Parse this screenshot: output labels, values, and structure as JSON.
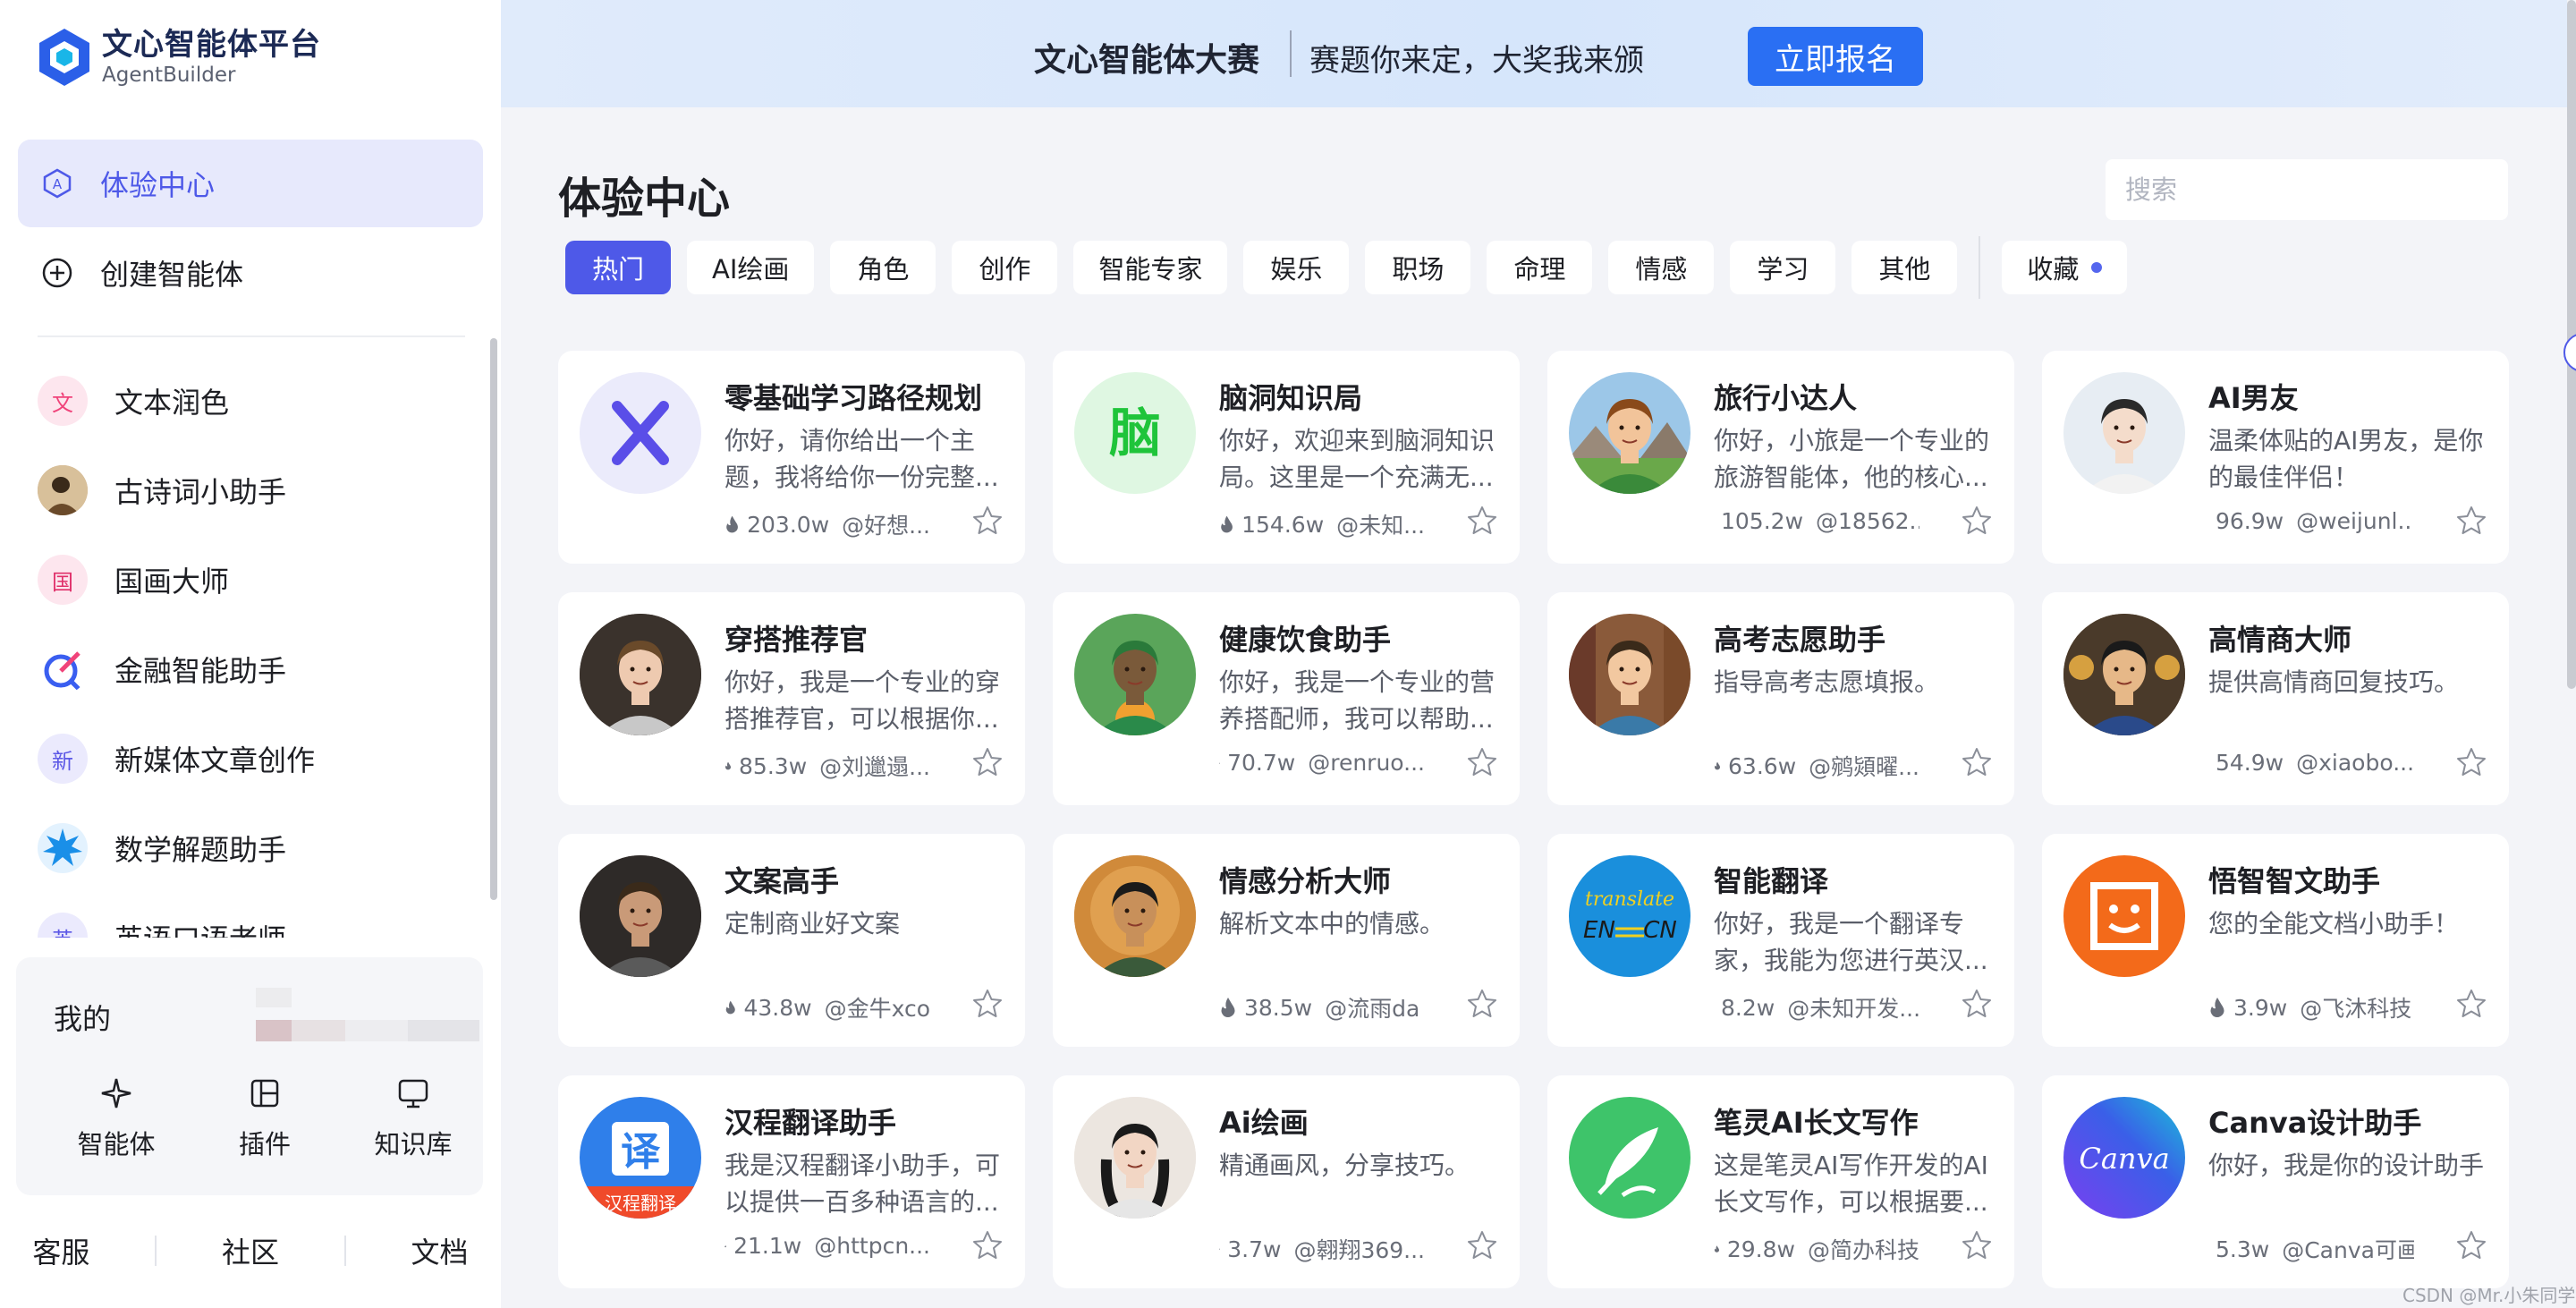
{
  "brand": {
    "title": "文心智能体平台",
    "subtitle": "AgentBuilder"
  },
  "nav": {
    "experience": "体验中心",
    "create": "创建智能体"
  },
  "recent": [
    {
      "label": "文本润色",
      "icon_text": "文",
      "color": "#f0437a",
      "bg": "#fde6ee"
    },
    {
      "label": "古诗词小助手",
      "icon_text": "",
      "color": "#7a5a3a",
      "bg": "#c9a27a"
    },
    {
      "label": "国画大师",
      "icon_text": "国",
      "color": "#e0306a",
      "bg": "#fde6ee"
    },
    {
      "label": "金融智能助手",
      "icon_text": "",
      "color": "#3a5ef0",
      "bg": "#ffffff"
    },
    {
      "label": "新媒体文章创作",
      "icon_text": "新",
      "color": "#5c58e6",
      "bg": "#ebeafd"
    },
    {
      "label": "数学解题助手",
      "icon_text": "",
      "color": "#1a8fe8",
      "bg": "#e3f2fe"
    },
    {
      "label": "英语口语老师",
      "icon_text": "英",
      "color": "#5c58e6",
      "bg": "#ebeafd"
    }
  ],
  "mine": {
    "label": "我的",
    "tabs": [
      "智能体",
      "插件",
      "知识库"
    ]
  },
  "footer": [
    "客服",
    "社区",
    "文档"
  ],
  "banner": {
    "title": "文心智能体大赛",
    "subtitle": "赛题你来定，大奖我来颁",
    "button": "立即报名"
  },
  "page": {
    "title": "体验中心",
    "search_placeholder": "搜索"
  },
  "categories": [
    "热门",
    "AI绘画",
    "角色",
    "创作",
    "智能专家",
    "娱乐",
    "职场",
    "命理",
    "情感",
    "学习",
    "其他"
  ],
  "favorites": "收藏",
  "cards": [
    {
      "title": "零基础学习路径规划",
      "desc": "你好，请你给出一个主题，我将给你一份完整...",
      "views": "203.0w",
      "author": "@好想...",
      "avatar": "x-mark",
      "bg": "#ebebfb"
    },
    {
      "title": "脑洞知识局",
      "desc": "你好，欢迎来到脑洞知识局。这里是一个充满无...",
      "views": "154.6w",
      "author": "@未知...",
      "avatar": "brain-char",
      "bg": "#dff7e2"
    },
    {
      "title": "旅行小达人",
      "desc": "你好，小旅是一个专业的旅游智能体，他的核心...",
      "views": "105.2w",
      "author": "@18562...",
      "avatar": "traveler",
      "bg": "#9cc7e8"
    },
    {
      "title": "AI男友",
      "desc": "温柔体贴的AI男友，是你的最佳伴侣！",
      "views": "96.9w",
      "author": "@weijunl...",
      "avatar": "boyfriend",
      "bg": "#e7edf3"
    },
    {
      "title": "穿搭推荐官",
      "desc": "你好，我是一个专业的穿搭推荐官，可以根据你...",
      "views": "85.3w",
      "author": "@刘邋遢...",
      "avatar": "fashion",
      "bg": "#4a4038"
    },
    {
      "title": "健康饮食助手",
      "desc": "你好，我是一个专业的营养搭配师，我可以帮助...",
      "views": "70.7w",
      "author": "@renruo...",
      "avatar": "diet",
      "bg": "#5aa55a"
    },
    {
      "title": "高考志愿助手",
      "desc": "指导高考志愿填报。",
      "views": "63.6w",
      "author": "@鹓熲曜...",
      "avatar": "exam",
      "bg": "#8a5a3a"
    },
    {
      "title": "高情商大师",
      "desc": "提供高情商回复技巧。",
      "views": "54.9w",
      "author": "@xiaobo...",
      "avatar": "eq",
      "bg": "#6a5030"
    },
    {
      "title": "文案高手",
      "desc": "定制商业好文案",
      "views": "43.8w",
      "author": "@金牛xco",
      "avatar": "copywriter",
      "bg": "#5a4a42"
    },
    {
      "title": "情感分析大师",
      "desc": "解析文本中的情感。",
      "views": "38.5w",
      "author": "@流雨da",
      "avatar": "emotion",
      "bg": "#c07a3a"
    },
    {
      "title": "智能翻译",
      "desc": "你好，我是一个翻译专家，我能为您进行英汉...",
      "views": "8.2w",
      "author": "@未知开发...",
      "avatar": "translate",
      "bg": "#1a8fdc"
    },
    {
      "title": "悟智智文助手",
      "desc": "您的全能文档小助手！",
      "views": "3.9w",
      "author": "@飞沐科技",
      "avatar": "doc-face",
      "bg": "#f36a1a"
    },
    {
      "title": "汉程翻译助手",
      "desc": "我是汉程翻译小助手，可以提供一百多种语言的...",
      "views": "21.1w",
      "author": "@httpcn...",
      "avatar": "yi",
      "bg": "#2f7fea"
    },
    {
      "title": "Ai绘画",
      "desc": "精通画风，分享技巧。",
      "views": "3.7w",
      "author": "@翱翔369...",
      "avatar": "portrait",
      "bg": "#e8e2dc"
    },
    {
      "title": "笔灵AI长文写作",
      "desc": "这是笔灵AI写作开发的AI长文写作，可以根据要...",
      "views": "29.8w",
      "author": "@简办科技",
      "avatar": "feather",
      "bg": "#3ec46a"
    },
    {
      "title": "Canva设计助手",
      "desc": "你好，我是你的设计助手",
      "views": "5.3w",
      "author": "@Canva可画",
      "avatar": "canva",
      "bg": "#5a3fe0"
    }
  ],
  "translate_logo": {
    "top": "translate",
    "left": "EN",
    "right": "CN"
  },
  "yi_logo": {
    "char": "译",
    "sub": "汉程翻译"
  },
  "brain_char": "脑",
  "canva_logo": "Canva",
  "watermark": "CSDN @Mr.小朱同学",
  "colors": {
    "accent": "#4e59e8",
    "banner_button": "#2a6ff3",
    "page_bg": "#f3f4f8"
  }
}
